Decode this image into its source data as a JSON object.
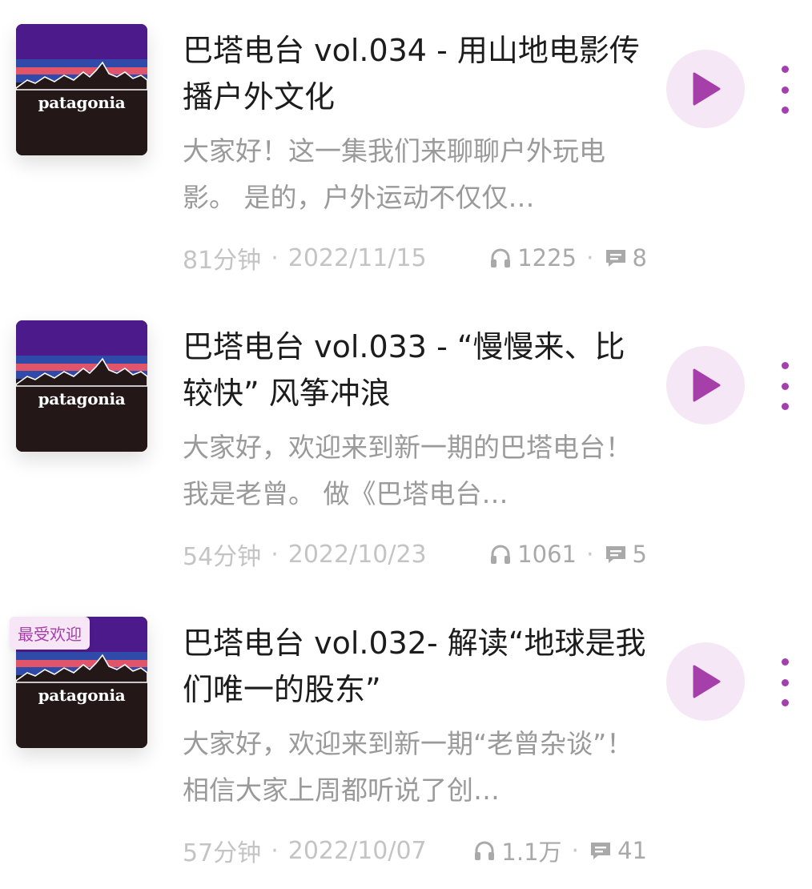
{
  "episodes": [
    {
      "cover_text": "patagonia",
      "title": "巴塔电台 vol.034 - 用山地电影传播户外文化",
      "description": "大家好！这一集我们来聊聊户外玩电影。 是的，户外运动不仅仅…",
      "duration": "81分钟",
      "date": "2022/11/15",
      "plays": "1225",
      "comments": "8"
    },
    {
      "cover_text": "patagonia",
      "title": "巴塔电台 vol.033 - “慢慢来、比较快” 风筝冲浪",
      "description": "大家好，欢迎来到新一期的巴塔电台！我是老曾。 做《巴塔电台…",
      "duration": "54分钟",
      "date": "2022/10/23",
      "plays": "1061",
      "comments": "5"
    },
    {
      "cover_text": "patagonia",
      "badge": "最受欢迎",
      "title": "巴塔电台 vol.032- 解读“地球是我们唯一的股东”",
      "description": "大家好，欢迎来到新一期“老曾杂谈”！ 相信大家上周都听说了创…",
      "duration": "57分钟",
      "date": "2022/10/07",
      "plays": "1.1万",
      "comments": "41"
    }
  ],
  "separator": "·",
  "icons": {
    "play": "play-icon",
    "more": "more-vertical-icon",
    "plays": "headphones-icon",
    "comments": "comment-icon"
  },
  "colors": {
    "accent": "#a63fa9",
    "play_bg": "#f6e7f7",
    "title": "#1c1c1c",
    "description": "#9a9a9a",
    "meta": "#c4c4c4",
    "cover_bg": "#241718",
    "cover_purple": "#4d1a8c",
    "cover_blue": "#2f4aa8",
    "cover_red": "#e0556a"
  }
}
